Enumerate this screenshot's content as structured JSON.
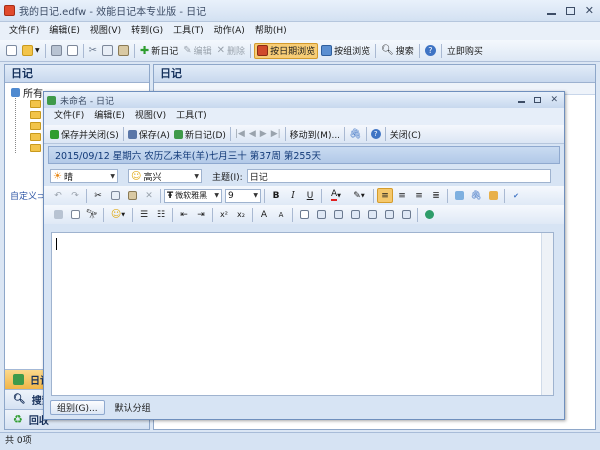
{
  "app": {
    "title": "我的日记.edfw - 效能日记本专业版 - 日记"
  },
  "main_menu": [
    "文件(F)",
    "编辑(E)",
    "视图(V)",
    "转到(G)",
    "工具(T)",
    "动作(A)",
    "帮助(H)"
  ],
  "main_toolbar": {
    "new_diary": "新日记",
    "edit": "编辑",
    "delete": "删除",
    "browse_by_date": "按日期浏览",
    "browse_by_group": "按组浏览",
    "search": "搜索",
    "buy_now": "立即购买"
  },
  "left_panel": {
    "header": "日记",
    "tree_root": "所有",
    "custom_label": "自定义⊃",
    "nav": [
      "日记",
      "搜索",
      "回收"
    ]
  },
  "right_panel": {
    "header": "日记"
  },
  "status": {
    "text": "共 0项"
  },
  "child": {
    "title": "未命名 - 日记",
    "menu": [
      "文件(F)",
      "编辑(E)",
      "视图(V)",
      "工具(T)"
    ],
    "toolbar": {
      "save_close": "保存并关闭(S)",
      "save": "保存(A)",
      "new_diary": "新日记(D)",
      "move_to": "移动到(M)...",
      "close": "关闭(C)"
    },
    "date_line": "2015/09/12 星期六 农历乙未年(羊)七月三十 第37周 第255天",
    "weather": "晴",
    "mood": "高兴",
    "subject_label": "主题(I):",
    "subject_value": "日记",
    "font_name": "微软雅黑",
    "font_size": "9",
    "group_button": "组别(G)...",
    "group_value": "默认分组"
  },
  "colors": {
    "accent": "#f5c86c",
    "header_text": "#15315c",
    "date_text": "#123a78"
  }
}
